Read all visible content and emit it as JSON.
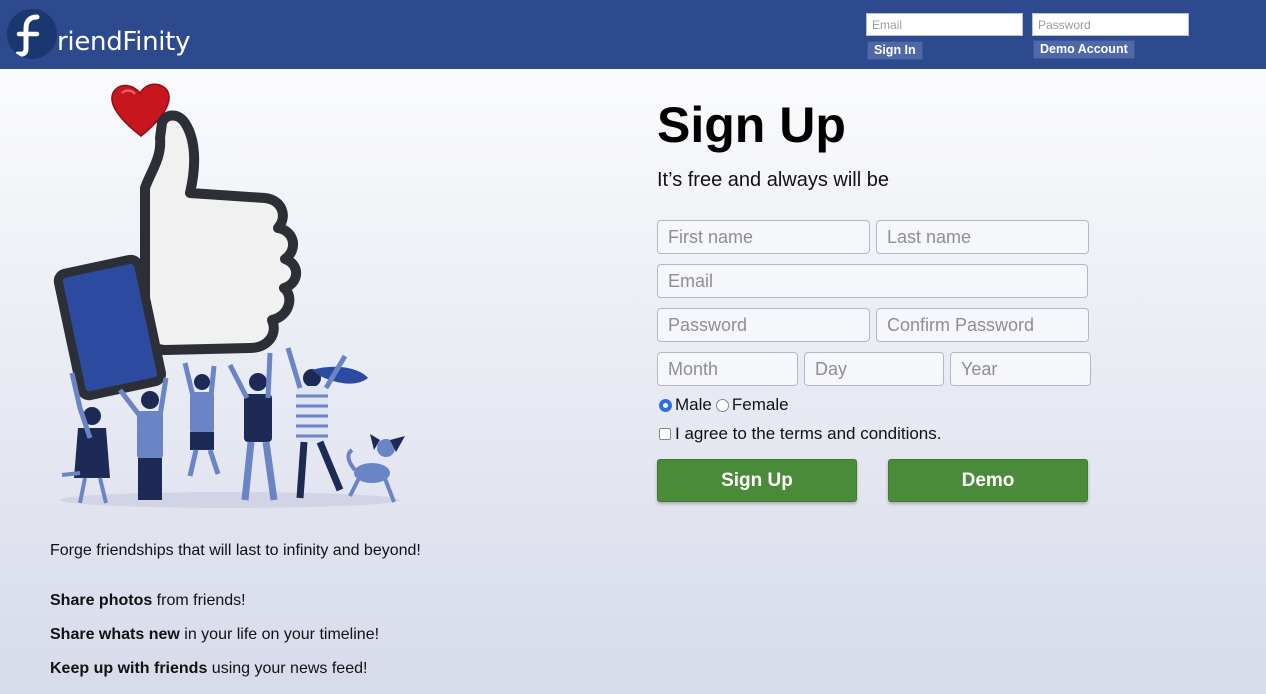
{
  "header": {
    "logo_mark": "f",
    "logo_text": "riendFinity",
    "email_placeholder": "Email",
    "password_placeholder": "Password",
    "signin_label": "Sign In",
    "demo_account_label": "Demo Account"
  },
  "hero": {
    "tagline": "Forge friendships that will last to infinity and beyond!",
    "features": [
      {
        "bold": "Share photos",
        "rest": " from friends!"
      },
      {
        "bold": "Share whats new",
        "rest": " in your life on your timeline!"
      },
      {
        "bold": "Keep up with friends",
        "rest": " using your news feed!"
      }
    ]
  },
  "signup": {
    "title": "Sign Up",
    "subtitle": "It’s free and always will be",
    "fields": {
      "first_name": "First name",
      "last_name": "Last name",
      "email": "Email",
      "password": "Password",
      "confirm_password": "Confirm Password",
      "month": "Month",
      "day": "Day",
      "year": "Year"
    },
    "gender": {
      "male": "Male",
      "female": "Female",
      "selected": "Male"
    },
    "terms_label": "I agree to the terms and conditions.",
    "signup_button": "Sign Up",
    "demo_button": "Demo"
  },
  "colors": {
    "header_bg": "#2e4a8e",
    "button_green": "#4a8b3a",
    "header_button": "#4f68a8"
  }
}
